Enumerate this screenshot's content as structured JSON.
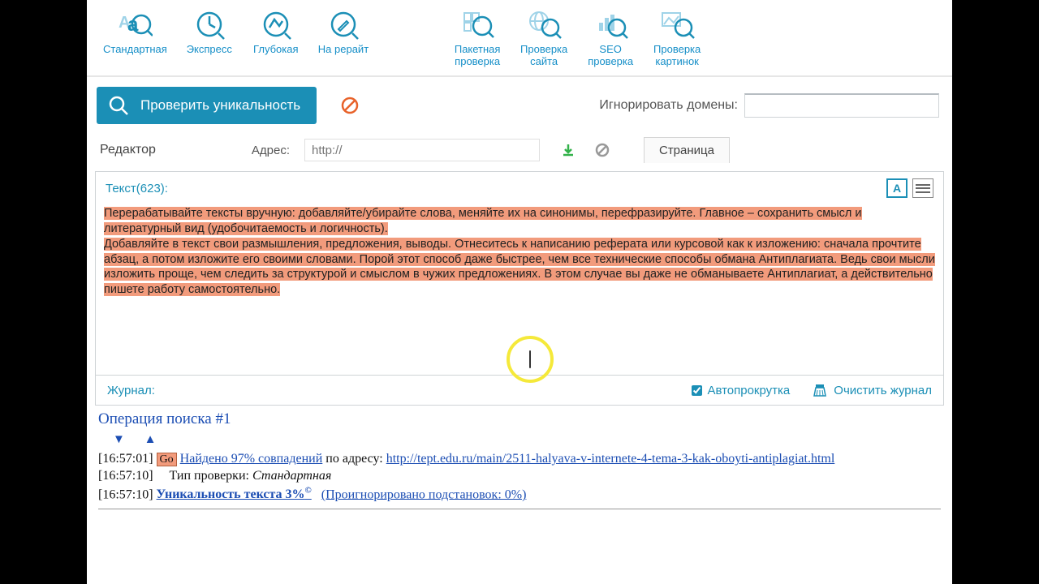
{
  "toolbar": {
    "items": [
      {
        "label": "Стандартная",
        "icon": "aa-mag"
      },
      {
        "label": "Экспресс",
        "icon": "clock-mag"
      },
      {
        "label": "Глубокая",
        "icon": "deep-mag"
      },
      {
        "label": "На рерайт",
        "icon": "pen-mag"
      },
      {
        "label": "Пакетная\nпроверка",
        "icon": "batch-mag"
      },
      {
        "label": "Проверка\nсайта",
        "icon": "globe-mag"
      },
      {
        "label": "SEO\nпроверка",
        "icon": "seo-mag"
      },
      {
        "label": "Проверка\nкартинок",
        "icon": "image-mag"
      }
    ]
  },
  "actionbar": {
    "check_label": "Проверить уникальность",
    "ignore_label": "Игнорировать домены:"
  },
  "editorbar": {
    "editor_label": "Редактор",
    "addr_label": "Адрес:",
    "addr_placeholder": "http://",
    "tab_label": "Страница"
  },
  "textpanel": {
    "header": "Текст(623):",
    "paragraph1": "Перерабатывайте тексты вручную: добавляйте/убирайте слова, меняйте их на синонимы, перефразируйте. Главное – сохранить смысл и литературный вид (удобочитаемость и логичность).",
    "paragraph2": "Добавляйте в текст свои размышления, предложения, выводы. Отнеситесь к написанию реферата или курсовой как к изложению: сначала прочтите абзац, а потом изложите его своими словами. Порой этот способ даже быстрее, чем все технические способы обмана Антиплагиата. Ведь свои мысли изложить проще, чем следить за структурой и смыслом в чужих предложениях. В этом случае вы даже не обманываете Антиплагиат, а действительно пишете работу самостоятельно."
  },
  "journal": {
    "label": "Журнал:",
    "autoscroll_label": "Автопрокрутка",
    "clear_label": "Очистить журнал"
  },
  "log": {
    "title": "Операция поиска #1",
    "line1_time": "[16:57:01]",
    "line1_go": "Go",
    "line1_found": "Найдено 97% совпадений",
    "line1_mid": " по адресу: ",
    "line1_url": "http://tept.edu.ru/main/2511-halyava-v-internete-4-tema-3-kak-oboyti-antiplagiat.html",
    "line2_time": "[16:57:10]",
    "line2_label": "Тип проверки: ",
    "line2_value": "Стандартная",
    "line3_time": "[16:57:10]",
    "line3_uniq": "Уникальность текста 3%",
    "line3_copy": "©",
    "line3_ignored": "(Проигнорировано подстановок: 0%)"
  }
}
